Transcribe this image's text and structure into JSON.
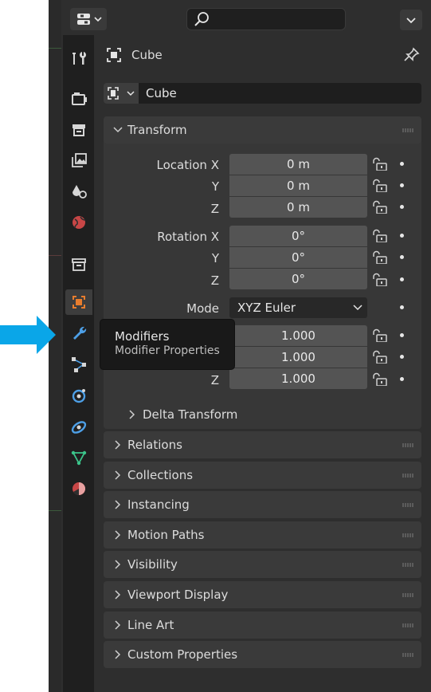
{
  "header": {
    "editor_type_icon": "editor-type-icon",
    "search_icon": "search-icon",
    "options_icon": "chevron-down-icon"
  },
  "tabs": [
    {
      "name": "tool",
      "icon": "wrench-screwdriver-icon"
    },
    {
      "name": "render",
      "icon": "render-camera-icon"
    },
    {
      "name": "output",
      "icon": "printer-icon"
    },
    {
      "name": "view-layer",
      "icon": "images-icon"
    },
    {
      "name": "scene",
      "icon": "scene-icon"
    },
    {
      "name": "world",
      "icon": "globe-icon"
    },
    {
      "name": "collection",
      "icon": "box-icon"
    },
    {
      "name": "object",
      "icon": "object-square-icon",
      "active": true
    },
    {
      "name": "modifiers",
      "icon": "wrench-icon"
    },
    {
      "name": "particles",
      "icon": "particles-icon"
    },
    {
      "name": "physics",
      "icon": "physics-icon"
    },
    {
      "name": "constraints",
      "icon": "constraint-icon"
    },
    {
      "name": "data",
      "icon": "mesh-data-icon"
    },
    {
      "name": "material",
      "icon": "material-sphere-icon"
    }
  ],
  "object": {
    "title": "Cube",
    "name_value": "Cube"
  },
  "transform": {
    "title": "Transform",
    "location_label": "Location X",
    "location": [
      {
        "axis": "Location X",
        "value": "0 m"
      },
      {
        "axis": "Y",
        "value": "0 m"
      },
      {
        "axis": "Z",
        "value": "0 m"
      }
    ],
    "rotation": [
      {
        "axis": "Rotation X",
        "value": "0°"
      },
      {
        "axis": "Y",
        "value": "0°"
      },
      {
        "axis": "Z",
        "value": "0°"
      }
    ],
    "mode_label": "Mode",
    "mode_value": "XYZ Euler",
    "scale": [
      {
        "axis": "",
        "value": "1.000"
      },
      {
        "axis": "",
        "value": "1.000"
      },
      {
        "axis": "Z",
        "value": "1.000"
      }
    ],
    "delta": "Delta Transform"
  },
  "sections": [
    "Relations",
    "Collections",
    "Instancing",
    "Motion Paths",
    "Visibility",
    "Viewport Display",
    "Line Art",
    "Custom Properties"
  ],
  "tooltip": {
    "title": "Modifiers",
    "subtitle": "Modifier Properties"
  },
  "colors": {
    "accent_arrow": "#0aa6e8",
    "active_object_icon": "#e87d2e"
  }
}
